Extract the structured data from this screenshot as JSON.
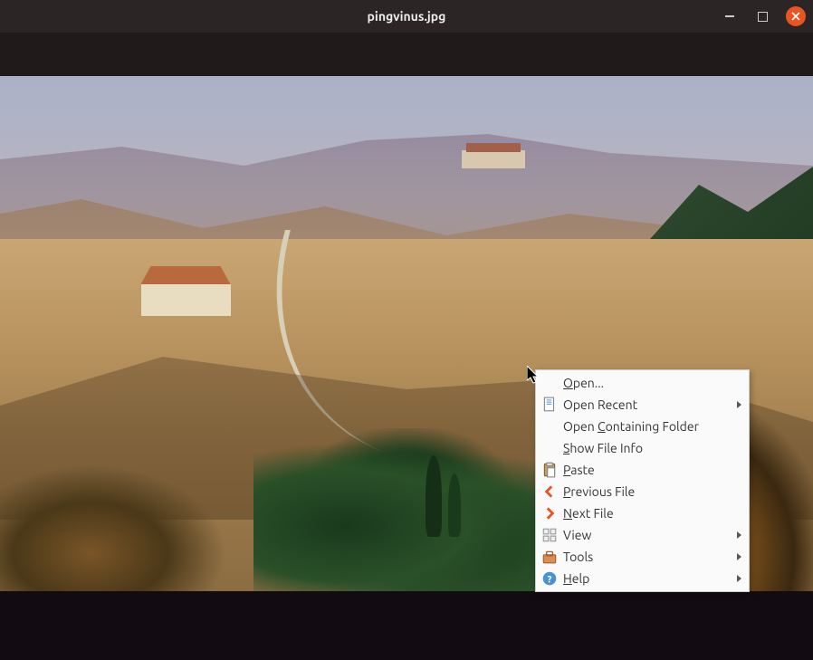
{
  "window": {
    "title": "pingvinus.jpg"
  },
  "context_menu": {
    "open": "Open...",
    "open_recent": "Open Recent",
    "open_containing": "Open Containing Folder",
    "show_file_info": "Show File Info",
    "paste": "Paste",
    "previous_file": "Previous File",
    "next_file": "Next File",
    "view": "View",
    "tools": "Tools",
    "help": "Help"
  },
  "icons": {
    "document": "document-icon",
    "paste": "paste-icon",
    "prev": "chevron-left-orange",
    "next": "chevron-right-orange",
    "view": "grid-icon",
    "tools": "toolbox-icon",
    "help": "help-icon"
  }
}
